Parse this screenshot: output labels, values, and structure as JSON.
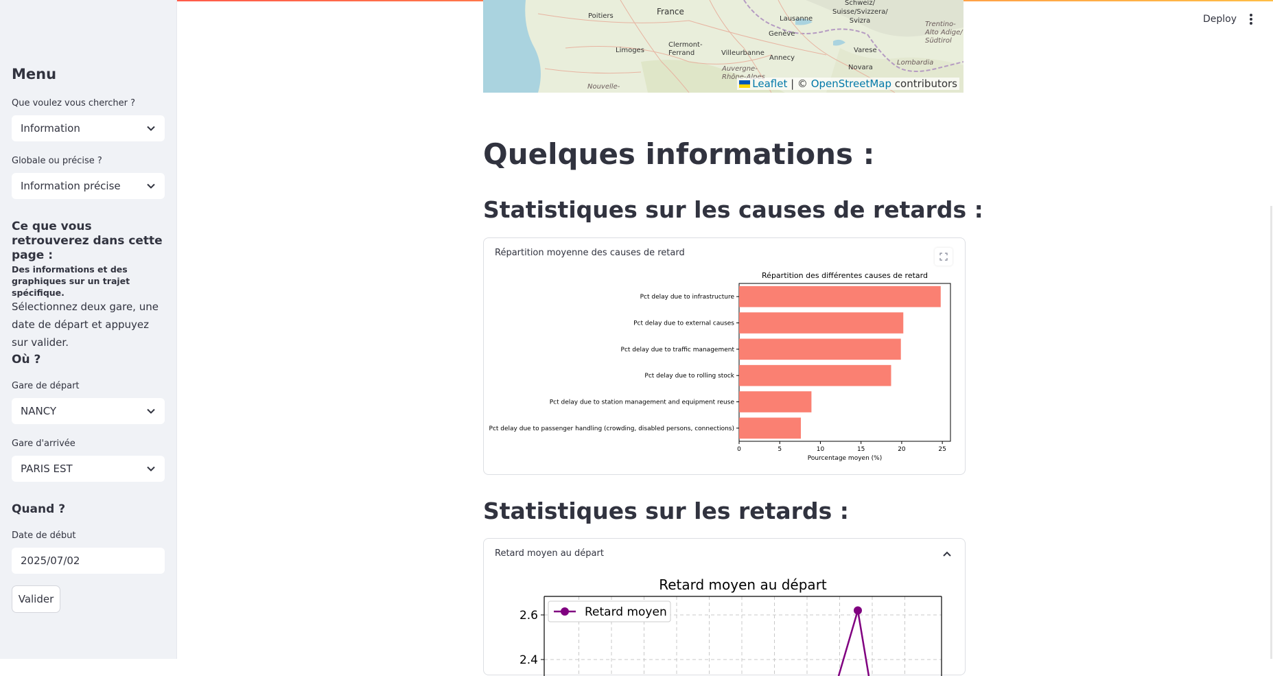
{
  "header": {
    "deploy_label": "Deploy",
    "menu_icon": "kebab-menu-icon"
  },
  "sidebar": {
    "title": "Menu",
    "search_label": "Que voulez vous chercher ?",
    "search_value": "Information",
    "scope_label": "Globale ou précise ?",
    "scope_value": "Information précise",
    "section_title": "Ce que vous retrouverez dans cette page :",
    "section_bold": "Des informations et des graphiques sur un trajet spécifique.",
    "section_text": "Sélectionnez deux gare, une date de départ et appuyez sur valider.",
    "where_title": "Où ?",
    "departure_label": "Gare de départ",
    "departure_value": "NANCY",
    "arrival_label": "Gare d'arrivée",
    "arrival_value": "PARIS EST",
    "when_title": "Quand ?",
    "date_label": "Date de début",
    "date_value": "2025/07/02",
    "submit_label": "Valider"
  },
  "map": {
    "places": [
      {
        "name": "Poitiers",
        "italic": false
      },
      {
        "name": "France",
        "italic": false
      },
      {
        "name": "Limoges",
        "italic": false
      },
      {
        "name": "Clermont-Ferrand",
        "italic": false
      },
      {
        "name": "Villeurbanne",
        "italic": false
      },
      {
        "name": "Annecy",
        "italic": false
      },
      {
        "name": "Genève",
        "italic": false
      },
      {
        "name": "Lausanne",
        "italic": false
      },
      {
        "name": "Schweiz/ Suisse/Svizzera/ Svizra",
        "italic": false
      },
      {
        "name": "Varese",
        "italic": false
      },
      {
        "name": "Novara",
        "italic": false
      },
      {
        "name": "Lombardia",
        "italic": true
      },
      {
        "name": "Trentino-Alto Adige/ Südtirol",
        "italic": true
      },
      {
        "name": "Auvergne-Rhône-Alpes",
        "italic": true
      },
      {
        "name": "Nouvelle-",
        "italic": true
      }
    ],
    "attribution": {
      "leaflet": "Leaflet",
      "separator": " | © ",
      "osm": "OpenStreetMap",
      "suffix": " contributors"
    },
    "colors": {
      "land": "#e9eedb",
      "water": "#aad3df",
      "border": "#b59bc2"
    }
  },
  "main": {
    "title": "Quelques informations :",
    "causes_heading": "Statistiques sur les causes de retards :",
    "delays_heading": "Statistiques sur les retards :"
  },
  "causes_card": {
    "title": "Répartition moyenne des causes de retard",
    "expand_icon": "fullscreen-icon"
  },
  "delays_card": {
    "title": "Retard moyen au départ",
    "toggle_icon": "chevron-up-icon"
  },
  "chart_data": [
    {
      "type": "bar",
      "orientation": "horizontal",
      "title": "Répartition des différentes causes de retard",
      "xlabel": "Pourcentage moyen (%)",
      "ylabel": "",
      "xlim": [
        0,
        26
      ],
      "xticks": [
        0,
        5,
        10,
        15,
        20,
        25
      ],
      "categories": [
        "Pct delay due to infrastructure",
        "Pct delay due to external causes",
        "Pct delay due to traffic management",
        "Pct delay due to rolling stock",
        "Pct delay due to station management and equipment reuse",
        "Pct delay due to passenger handling (crowding, disabled persons, connections)"
      ],
      "values": [
        24.8,
        20.2,
        19.9,
        18.7,
        8.9,
        7.6
      ],
      "color": "#fa8072"
    },
    {
      "type": "line",
      "title": "Retard moyen au départ",
      "legend": [
        "Retard moyen"
      ],
      "legend_position": "top-left",
      "yticks": [
        2.4,
        2.6
      ],
      "grid": true,
      "color": "#800080",
      "visible_point": {
        "y": 2.62
      }
    }
  ]
}
